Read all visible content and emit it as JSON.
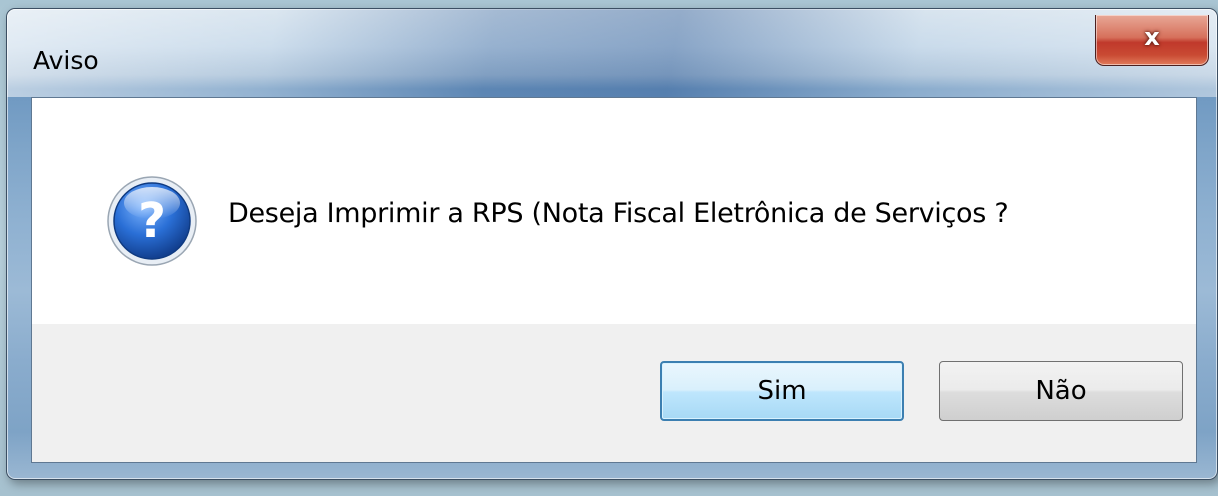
{
  "window": {
    "title": "Aviso",
    "close_glyph": "x"
  },
  "dialog": {
    "icon": "question-icon",
    "message": "Deseja Imprimir a RPS (Nota Fiscal Eletrônica de Serviços ?",
    "buttons": {
      "yes": "Sim",
      "no": "Não"
    }
  },
  "colors": {
    "default_button_border": "#3c7fb1",
    "close_button": "#c0392b",
    "icon_blue": "#1f5fc4"
  }
}
